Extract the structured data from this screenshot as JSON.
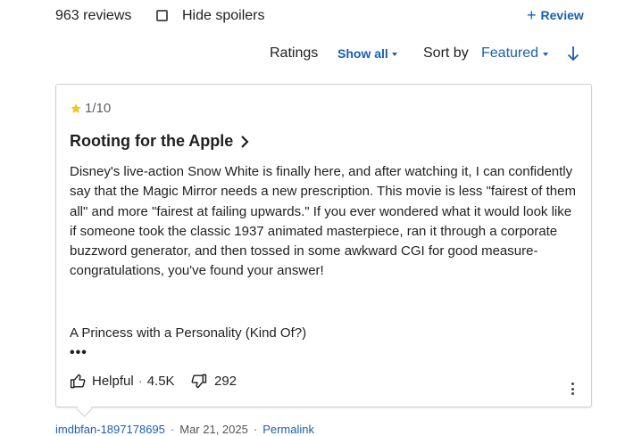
{
  "toolbar": {
    "review_count": "963 reviews",
    "hide_spoilers_label": "Hide spoilers",
    "hide_spoilers_checked": false,
    "review_button_label": "Review"
  },
  "filters": {
    "ratings_label": "Ratings",
    "ratings_value": "Show all",
    "sort_label": "Sort by",
    "sort_value": "Featured"
  },
  "review": {
    "rating": "1",
    "rating_scale": "/10",
    "title": "Rooting for the Apple",
    "body": "Disney's live-action Snow White is finally here, and after watching it, I can confidently say that the Magic Mirror needs a new prescription. This movie is less \"fairest of them all\" and more \"fairest at failing upwards.\" If you ever wondered what it would look like if someone took the classic 1937 animated masterpiece, ran it through a corporate buzzword generator, and then tossed in some awkward CGI for good measure-congratulations, you've found your answer!",
    "subheading": "A Princess with a Personality (Kind Of?)",
    "more_label": "•••",
    "helpful_label": "Helpful",
    "helpful_count": "4.5K",
    "unhelpful_count": "292",
    "author": "imdbfan-1897178695",
    "date": "Mar 21, 2025",
    "permalink_label": "Permalink"
  },
  "colors": {
    "accent": "#1a5fb4",
    "star": "#f5c518",
    "border": "#cfcfcf"
  },
  "icons": [
    "checkbox-icon",
    "plus-icon",
    "caret-down-icon",
    "sort-down-arrow-icon",
    "star-icon",
    "chevron-right-icon",
    "thumbs-up-icon",
    "thumbs-down-icon",
    "kebab-menu-icon"
  ]
}
